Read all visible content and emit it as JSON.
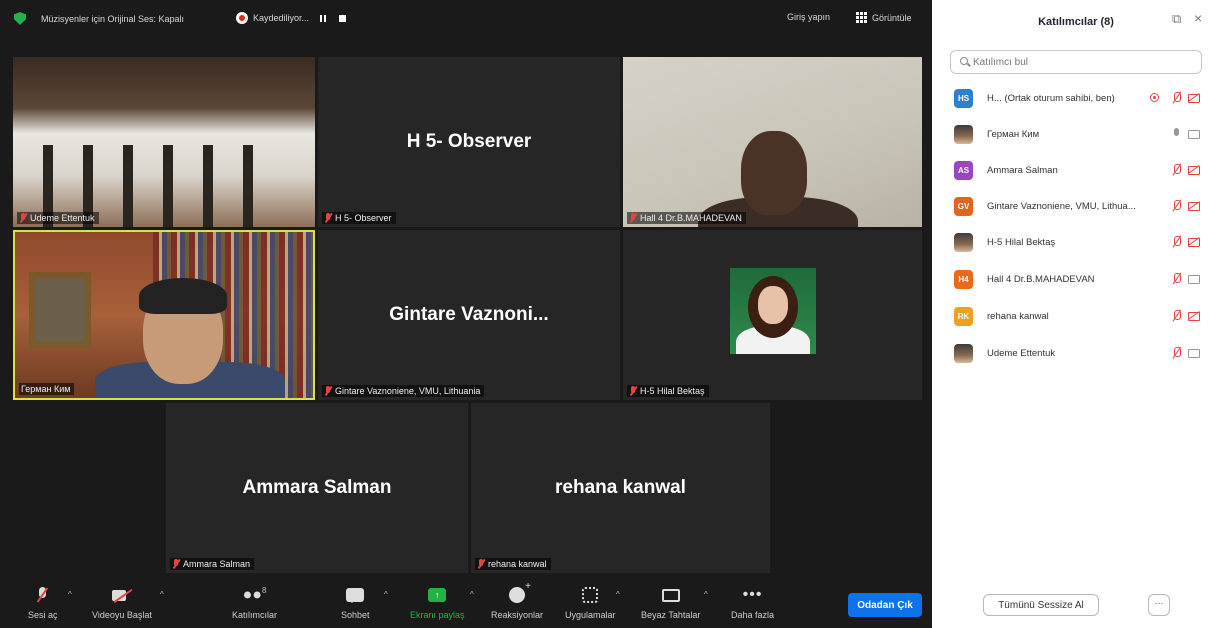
{
  "topbar": {
    "audio_mode": "Müzisyenler için Orijinal Ses: Kapalı",
    "recording": "Kaydediliyor...",
    "sign_in": "Giriş yapın",
    "view": "Görüntüle"
  },
  "tiles": [
    {
      "label": "Udeme Ettentuk",
      "big_name": ""
    },
    {
      "label": "H 5- Observer",
      "big_name": "H 5- Observer"
    },
    {
      "label": "Hall 4 Dr.B.MAHADEVAN",
      "big_name": ""
    },
    {
      "label": "Герман Ким",
      "big_name": ""
    },
    {
      "label": "Gintare Vaznoniene, VMU, Lithuania",
      "big_name": "Gintare  Vaznoni..."
    },
    {
      "label": "H-5 Hilal Bektaş",
      "big_name": ""
    },
    {
      "label": "Ammara Salman",
      "big_name": "Ammara Salman"
    },
    {
      "label": "rehana kanwal",
      "big_name": "rehana kanwal"
    }
  ],
  "toolbar": {
    "audio": "Sesi aç",
    "video": "Videoyu Başlat",
    "participants": "Katılımcılar",
    "participants_count": "8",
    "chat": "Sohbet",
    "share": "Ekranı paylaş",
    "reactions": "Reaksiyonlar",
    "apps": "Uygulamalar",
    "whiteboards": "Beyaz Tahtalar",
    "more": "Daha fazla",
    "leave": "Odadan Çık",
    "share_color": "#23b246",
    "leave_color": "#0e72ed"
  },
  "panel": {
    "title": "Katılımcılar (8)",
    "search_placeholder": "Katılımcı bul",
    "mute_all": "Tümünü Sessize Al",
    "more": "···",
    "participants": [
      {
        "initials": "HS",
        "color": "#2d7fcf",
        "name": "H... (Ortak oturum sahibi, ben)",
        "mic": "off",
        "cam": "off",
        "recording": true
      },
      {
        "initials": "",
        "color": "",
        "name": "Герман Ким",
        "mic": "on",
        "cam": "on",
        "recording": false
      },
      {
        "initials": "AS",
        "color": "#9b44c4",
        "name": "Ammara Salman",
        "mic": "off",
        "cam": "off",
        "recording": false
      },
      {
        "initials": "GV",
        "color": "#e0661f",
        "name": "Gintare Vaznoniene, VMU, Lithua...",
        "mic": "off",
        "cam": "off",
        "recording": false
      },
      {
        "initials": "",
        "color": "",
        "name": "H-5 Hilal Bektaş",
        "mic": "off",
        "cam": "off",
        "recording": false
      },
      {
        "initials": "H4",
        "color": "#e86a1a",
        "name": "Hall 4 Dr.B.MAHADEVAN",
        "mic": "off",
        "cam": "on",
        "recording": false
      },
      {
        "initials": "RK",
        "color": "#f0a020",
        "name": "rehana kanwal",
        "mic": "off",
        "cam": "off",
        "recording": false
      },
      {
        "initials": "",
        "color": "",
        "name": "Udeme Ettentuk",
        "mic": "off",
        "cam": "on",
        "recording": false
      }
    ]
  }
}
